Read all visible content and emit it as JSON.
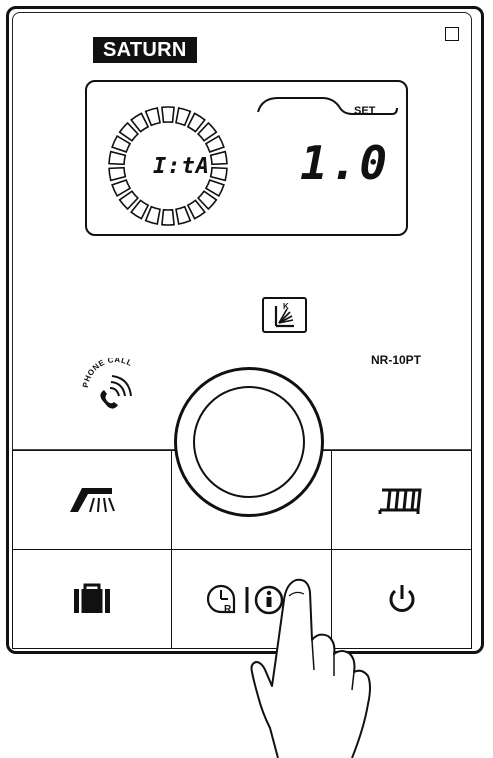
{
  "brand": "SATURN",
  "display": {
    "mode_text": "I:tA",
    "set_label": "SET",
    "set_value": "1.0"
  },
  "mode_icon_letter": "K",
  "model": "NR-10PT",
  "phone_call_label": "PHONE CALL",
  "buttons": [
    {
      "name": "hot-water-button",
      "icon": "hot-water-icon"
    },
    {
      "name": "heating-button",
      "icon": "radiator-icon"
    },
    {
      "name": "away-mode-button",
      "icon": "suitcase-icon"
    },
    {
      "name": "reset-info-button",
      "icon": "reset-info-icon",
      "reset_letter": "R"
    },
    {
      "name": "power-button",
      "icon": "power-icon"
    }
  ],
  "colors": {
    "ink": "#111111",
    "background": "#ffffff"
  }
}
